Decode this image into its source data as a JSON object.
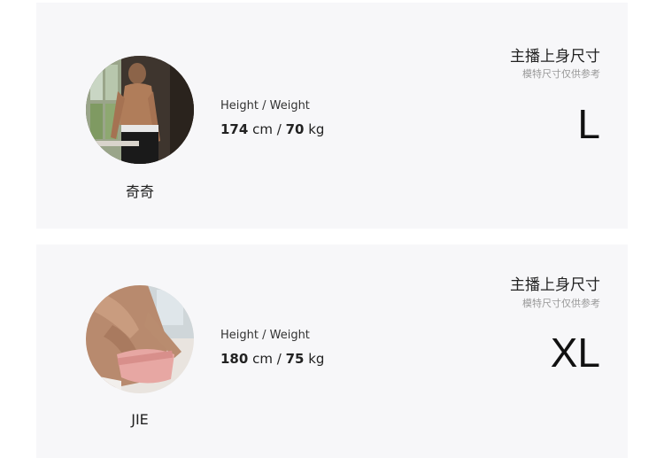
{
  "models": [
    {
      "name": "奇奇",
      "hw_label": "Height / Weight",
      "height": "174",
      "weight": "70",
      "unit_height": "cm",
      "unit_weight": "kg",
      "separator": "/",
      "size_title": "主播上身尺寸",
      "size_note": "模特尺寸仅供参考",
      "size": "L"
    },
    {
      "name": "JIE",
      "hw_label": "Height / Weight",
      "height": "180",
      "weight": "75",
      "unit_height": "cm",
      "unit_weight": "kg",
      "separator": "/",
      "size_title": "主播上身尺寸",
      "size_note": "模特尺寸仅供参考",
      "size": "XL"
    }
  ],
  "colors": {
    "card_bg": "#f7f7f9",
    "text": "#222222",
    "muted": "#999999"
  }
}
